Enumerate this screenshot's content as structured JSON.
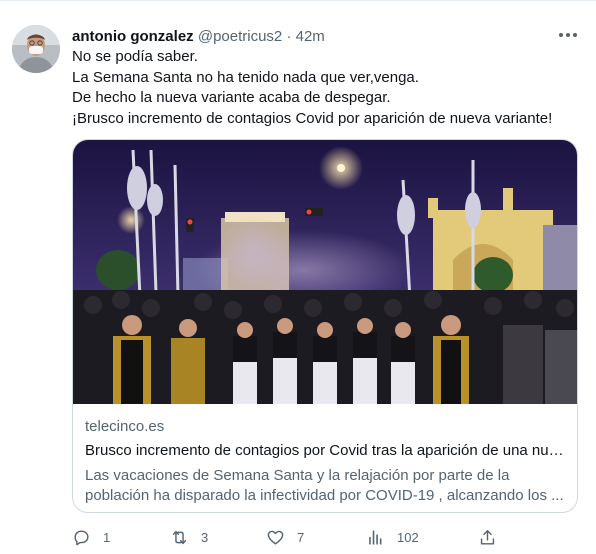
{
  "tweet": {
    "author_name": "antonio gonzalez",
    "handle": "@poetricus2",
    "separator": "·",
    "time": "42m",
    "lines": [
      "No se podía saber.",
      "La Semana Santa no ha tenido nada que ver,venga.",
      "De hecho la nueva variante acaba de despegar.",
      "¡Brusco incremento de contagios Covid por aparición de nueva variante!"
    ]
  },
  "card": {
    "domain": "telecinco.es",
    "title": "Brusco incremento de contagios por Covid tras la aparición de una nue...",
    "description": "Las vacaciones de Semana Santa y la relajación por parte de la población ha disparado la infectividad por COVID-19 , alcanzando los ..."
  },
  "actions": {
    "reply_count": "1",
    "retweet_count": "3",
    "like_count": "7",
    "views_count": "102"
  },
  "icons": {
    "more": "more-horizontal-icon",
    "reply": "reply-icon",
    "retweet": "retweet-icon",
    "like": "heart-icon",
    "views": "views-icon",
    "share": "share-icon"
  },
  "colors": {
    "text_primary": "#0f1419",
    "text_secondary": "#536471",
    "border": "#cfd9de"
  }
}
